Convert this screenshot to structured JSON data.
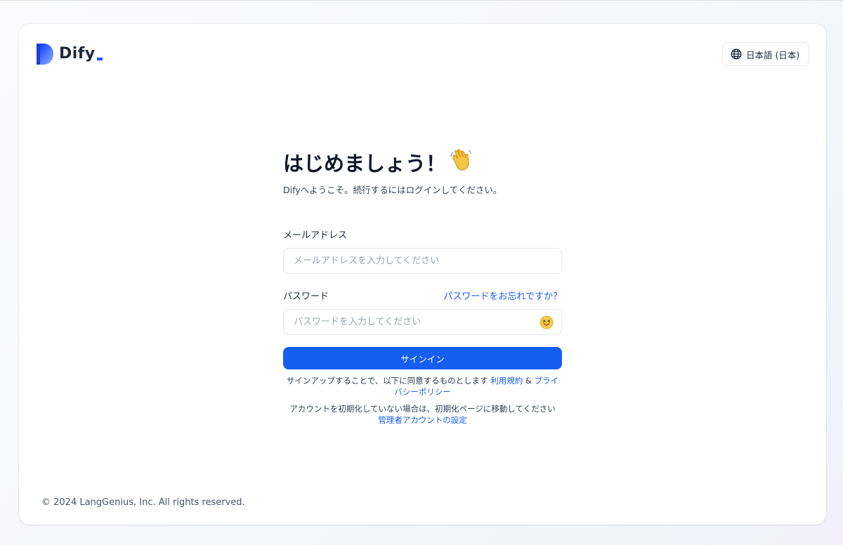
{
  "app": {
    "name": "Dify",
    "accent_color": "#155eef"
  },
  "header": {
    "language_label": "日本語 (日本)",
    "language_icon": "globe-icon"
  },
  "login": {
    "title": "はじめましょう！",
    "title_emoji": "waving-hand-icon",
    "subtitle": "Difyへようこそ。続行するにはログインしてください。",
    "email_label": "メールアドレス",
    "email_placeholder": "メールアドレスを入力してください",
    "email_value": "",
    "password_label": "パスワード",
    "forgot_link": "パスワードをお忘れですか？",
    "password_placeholder": "パスワードを入力してください",
    "password_value": "",
    "password_toggle_icon": "face-with-tongue-icon",
    "signin_label": "サインイン",
    "terms_prefix": "サインアップすることで、以下に同意するものとします ",
    "terms_link": "利用規約",
    "terms_amp": " & ",
    "privacy_link": "プライバシーポリシー",
    "init_prefix": "アカウントを初期化していない場合は、初期化ページに移動してください ",
    "init_link": "管理者アカウントの設定"
  },
  "footer": {
    "copyright": "© 2024 LangGenius, Inc. All rights reserved."
  }
}
